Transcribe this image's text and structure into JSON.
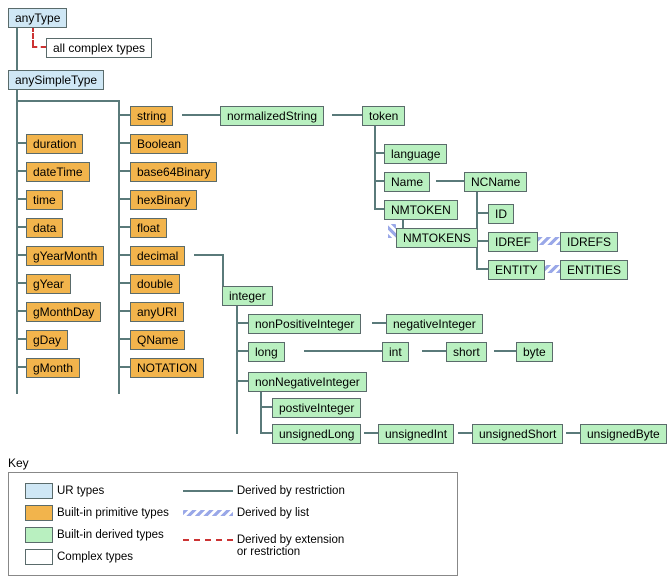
{
  "root": "anyType",
  "complex": "all complex types",
  "simpleRoot": "anySimpleType",
  "col1": {
    "duration": "duration",
    "dateTime": "dateTime",
    "time": "time",
    "data": "data",
    "gYearMonth": "gYearMonth",
    "gYear": "gYear",
    "gMonthDay": "gMonthDay",
    "gDay": "gDay",
    "gMonth": "gMonth"
  },
  "col2": {
    "string": "string",
    "Boolean": "Boolean",
    "base64Binary": "base64Binary",
    "hexBinary": "hexBinary",
    "float": "float",
    "decimal": "decimal",
    "double": "double",
    "anyURI": "anyURI",
    "QName": "QName",
    "NOTATION": "NOTATION"
  },
  "strTree": {
    "normalizedString": "normalizedString",
    "token": "token",
    "language": "language",
    "Name": "Name",
    "NMTOKEN": "NMTOKEN",
    "NMTOKENS": "NMTOKENS",
    "NCName": "NCName",
    "ID": "ID",
    "IDREF": "IDREF",
    "IDREFS": "IDREFS",
    "ENTITY": "ENTITY",
    "ENTITIES": "ENTITIES"
  },
  "numTree": {
    "integer": "integer",
    "nonPositiveInteger": "nonPositiveInteger",
    "negativeInteger": "negativeInteger",
    "long": "long",
    "int": "int",
    "short": "short",
    "byte": "byte",
    "nonNegativeInteger": "nonNegativeInteger",
    "positiveInteger": "postiveInteger",
    "unsignedLong": "unsignedLong",
    "unsignedInt": "unsignedInt",
    "unsignedShort": "unsignedShort",
    "unsignedByte": "unsignedByte"
  },
  "key": {
    "title": "Key",
    "ur": "UR types",
    "prim": "Built-in primitive types",
    "deriv": "Built-in derived types",
    "complex": "Complex types",
    "restr": "Derived by restriction",
    "list": "Derived by list",
    "ext": "Derived by extension\nor restriction"
  }
}
